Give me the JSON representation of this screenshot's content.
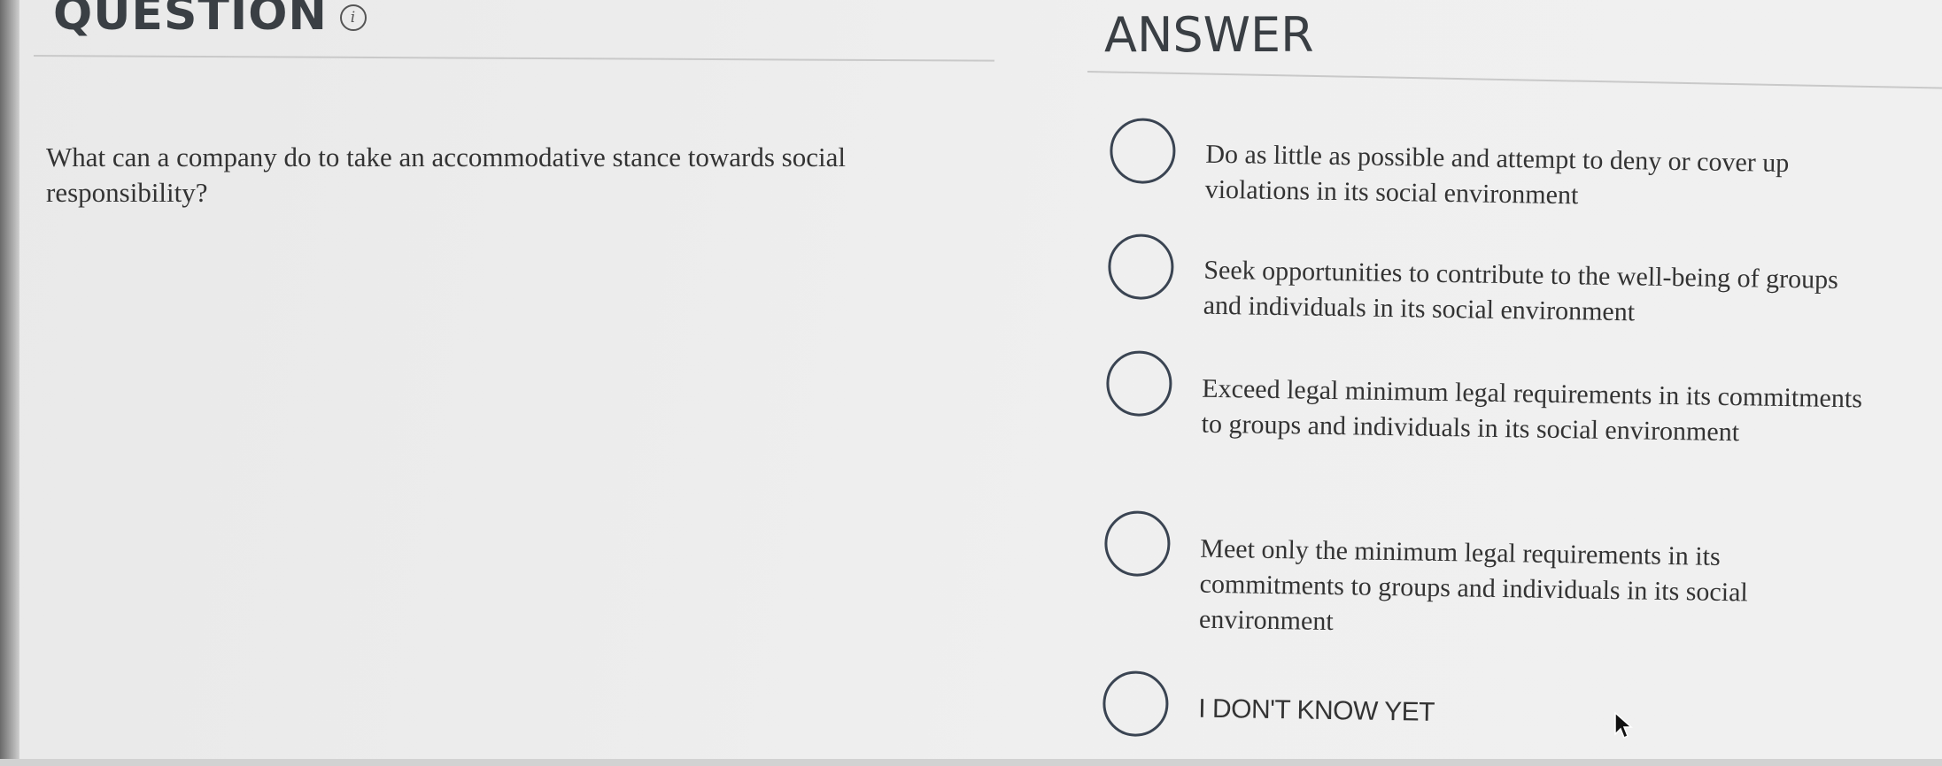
{
  "question": {
    "heading": "QUESTION",
    "info_icon": "info-icon",
    "text": "What can a company do to take an accommodative stance towards social responsibility?"
  },
  "answer": {
    "heading": "ANSWER",
    "options": [
      {
        "label": "Do as little as possible and attempt to deny or cover up violations in its social environment",
        "selected": false
      },
      {
        "label": "Seek opportunities to contribute to the well-being of groups and individuals in its social environment",
        "selected": false
      },
      {
        "label": "Exceed legal minimum legal requirements in its commitments to groups and individuals in its social environment",
        "selected": false
      },
      {
        "label": "Meet only the minimum legal requirements in its commitments to groups and individuals in its social environment",
        "selected": false
      },
      {
        "label": "I DON'T KNOW YET",
        "selected": false
      }
    ]
  },
  "colors": {
    "background": "#ececec",
    "text": "#333333",
    "heading": "#3a3f44",
    "radio_border": "#3a4452",
    "rule": "#c9c9c9"
  },
  "icons": {
    "radio": "radio-empty-icon",
    "pointer": "mouse-pointer-icon"
  }
}
